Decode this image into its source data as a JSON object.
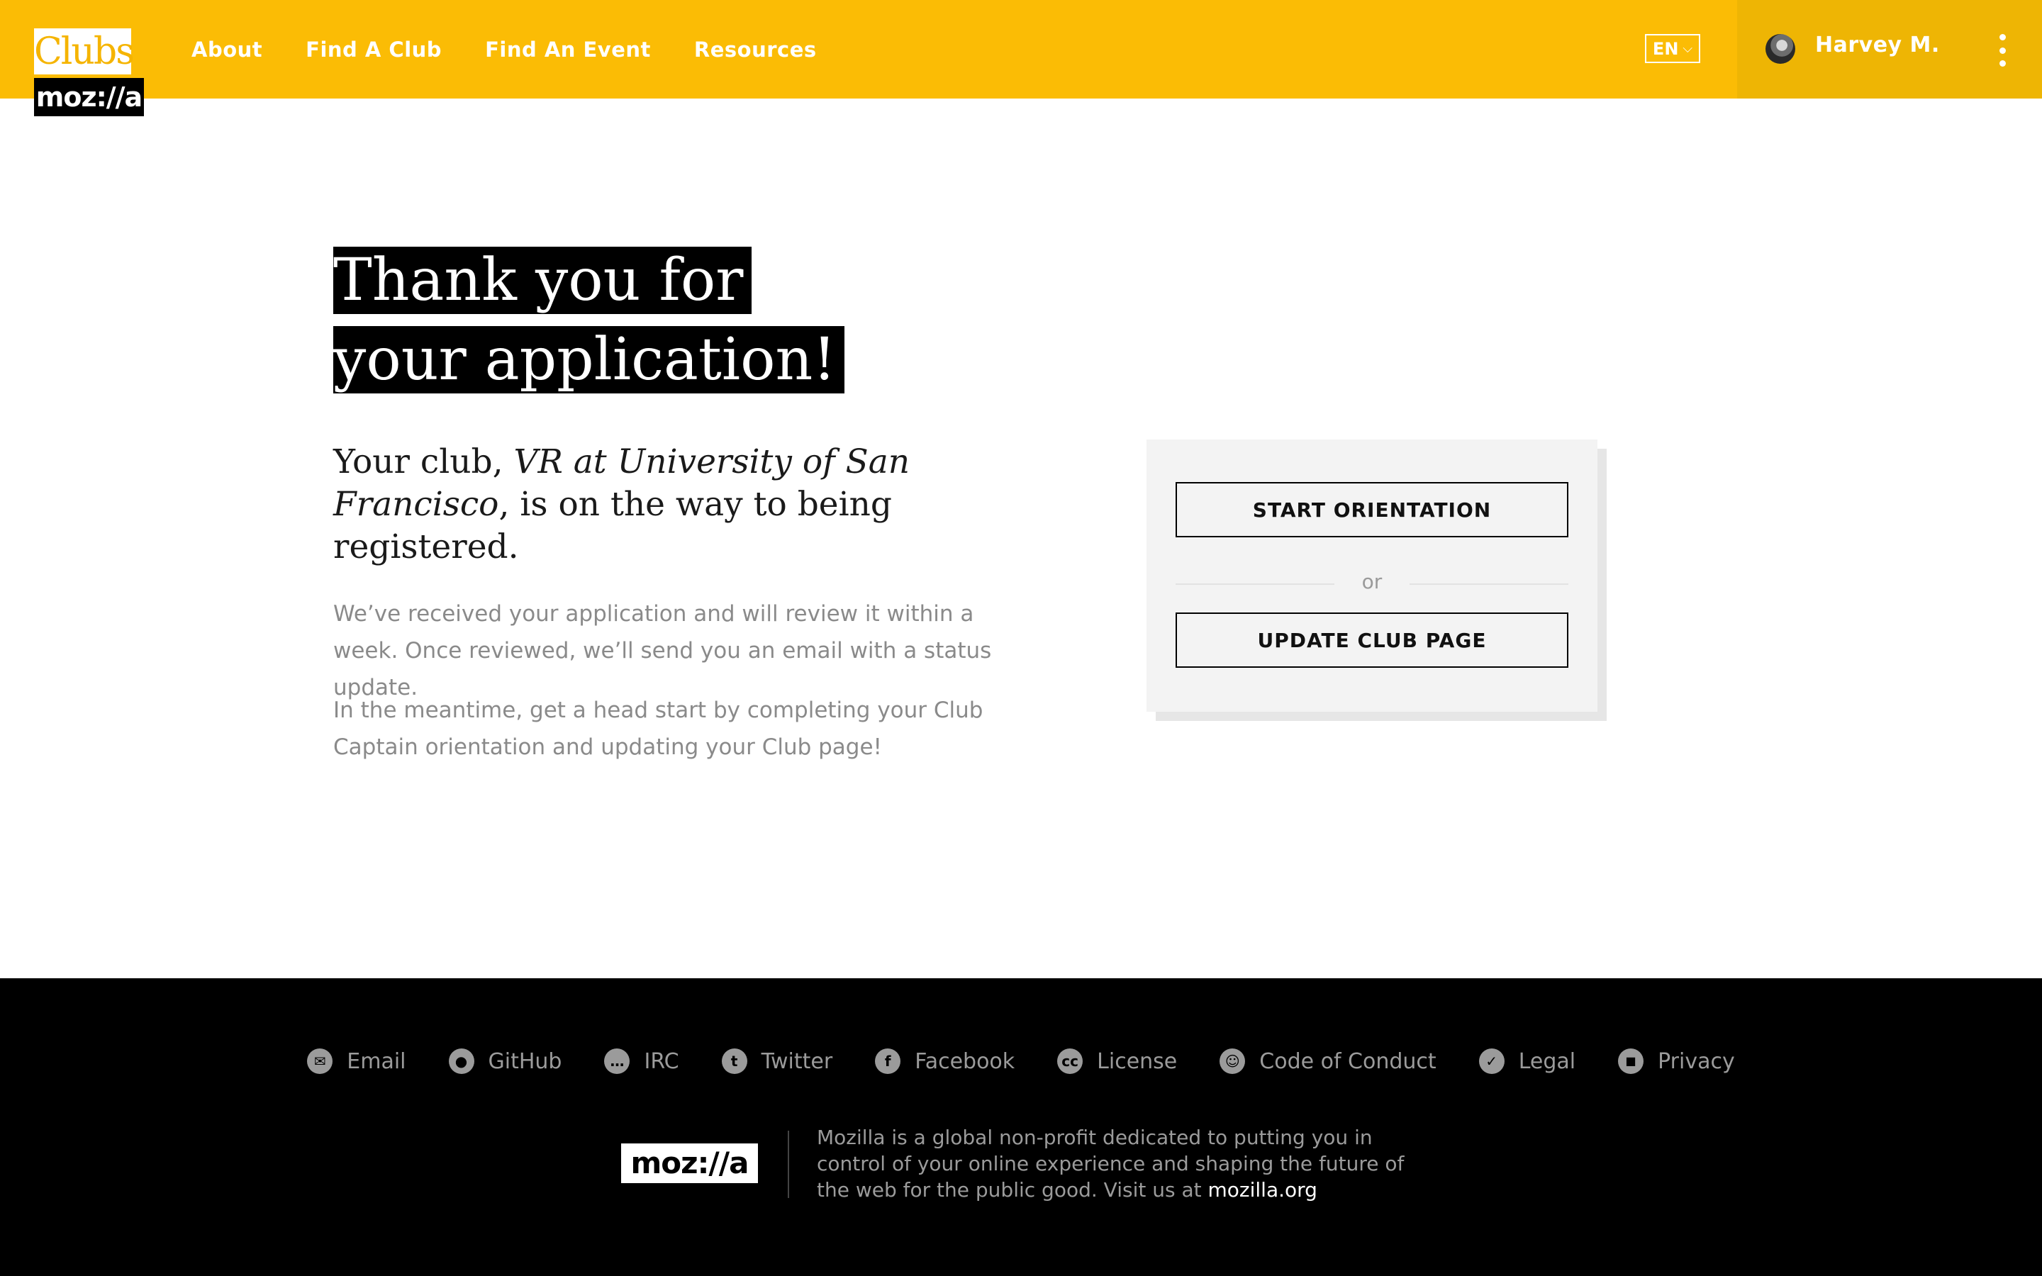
{
  "header": {
    "logo_top": "Clubs",
    "logo_bottom": "moz://a",
    "nav": [
      {
        "label": "About"
      },
      {
        "label": "Find A Club"
      },
      {
        "label": "Find An Event"
      },
      {
        "label": "Resources"
      }
    ],
    "language": "EN",
    "user_name": "Harvey M.",
    "accent_color": "#fbbc05"
  },
  "main": {
    "headline_line1": "Thank you for",
    "headline_line2": "your application!",
    "lead_prefix": "Your club, ",
    "club_name": "VR at University of San Francisco",
    "lead_suffix": ", is on the way to being registered.",
    "paragraph1": "We’ve received your application and will review it within a week. Once reviewed, we’ll send you an email with a status update.",
    "paragraph2": "In the meantime, get a head start by completing your Club Captain orientation and updating your Club page!",
    "card": {
      "start_orientation": "START ORIENTATION",
      "or": "or",
      "update_club_page": "UPDATE CLUB PAGE"
    }
  },
  "footer": {
    "links": [
      {
        "label": "Email",
        "icon": "email-icon",
        "glyph": "✉"
      },
      {
        "label": "GitHub",
        "icon": "github-icon",
        "glyph": "●"
      },
      {
        "label": "IRC",
        "icon": "chat-bubble-icon",
        "glyph": "…"
      },
      {
        "label": "Twitter",
        "icon": "twitter-icon",
        "glyph": "t"
      },
      {
        "label": "Facebook",
        "icon": "facebook-icon",
        "glyph": "f"
      },
      {
        "label": "License",
        "icon": "creative-commons-icon",
        "glyph": "cc"
      },
      {
        "label": "Code of Conduct",
        "icon": "smiley-icon",
        "glyph": "☺"
      },
      {
        "label": "Legal",
        "icon": "checkmark-icon",
        "glyph": "✓"
      },
      {
        "label": "Privacy",
        "icon": "lock-icon",
        "glyph": "🔒"
      }
    ],
    "logo": "moz://a",
    "description": "Mozilla is a global non-profit dedicated to putting you in control of your online experience and shaping the future of the web for the public good. Visit us at ",
    "site_link": "mozilla.org"
  }
}
